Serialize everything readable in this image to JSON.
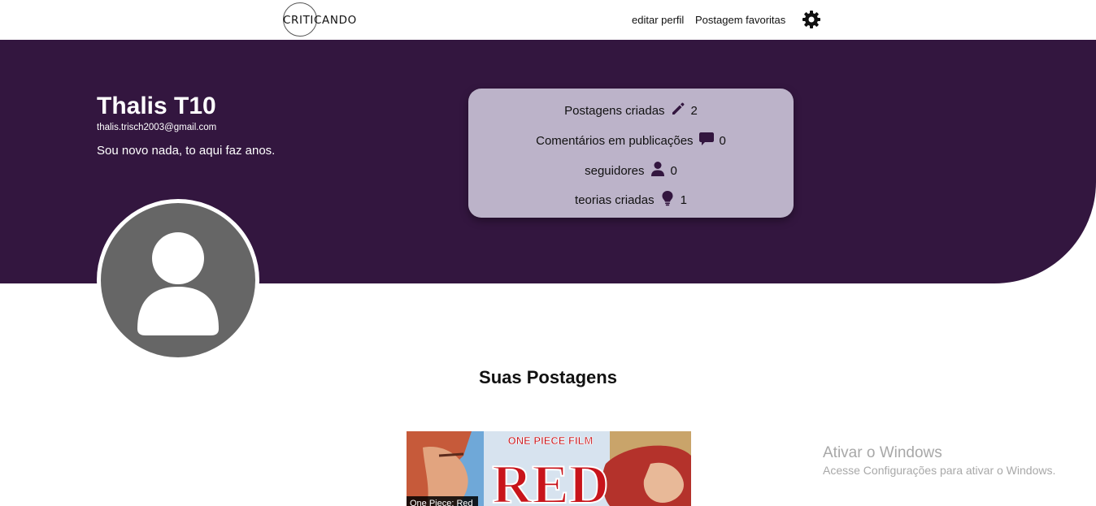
{
  "navbar": {
    "logo_text": "CRITICANDO",
    "links": [
      "editar perfil",
      "Postagem favoritas"
    ]
  },
  "profile": {
    "name": "Thalis T10",
    "email": "thalis.trisch2003@gmail.com",
    "bio": "Sou novo nada, to aqui faz anos."
  },
  "stats": [
    {
      "label": "Postagens criadas",
      "icon": "pencil-icon",
      "value": "2"
    },
    {
      "label": "Comentários em publicações",
      "icon": "comment-icon",
      "value": "0"
    },
    {
      "label": "seguidores",
      "icon": "user-icon",
      "value": "0"
    },
    {
      "label": "teorias criadas",
      "icon": "lightbulb-icon",
      "value": "1"
    }
  ],
  "posts_section": {
    "title": "Suas Postagens",
    "posts": [
      {
        "caption": "One Piece: Red",
        "poster_logo_top": "ONE PIECE FILM",
        "poster_logo_main": "RED"
      }
    ]
  },
  "watermark": {
    "title": "Ativar o Windows",
    "subtitle": "Acesse Configurações para ativar o Windows."
  },
  "colors": {
    "hero_bg": "#33163f",
    "stats_bg": "#bcb3c9",
    "avatar_bg": "#666666"
  }
}
